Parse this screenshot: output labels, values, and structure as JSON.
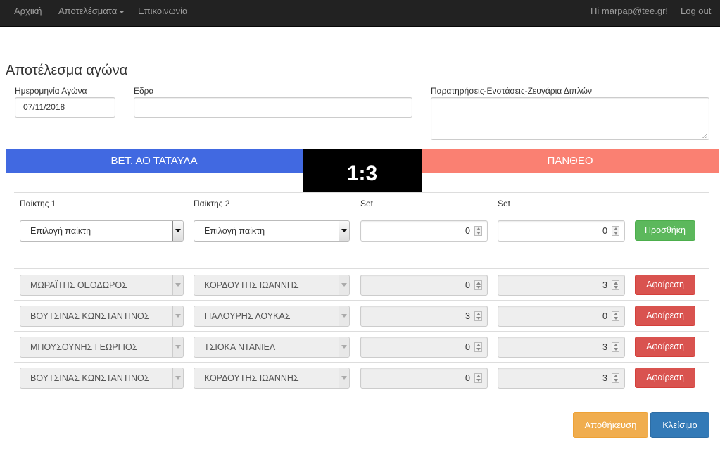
{
  "navbar": {
    "home": "Αρχική",
    "results": "Αποτελέσματα",
    "contact": "Επικοινωνία",
    "greeting": "Hi marpap@tee.gr!",
    "logout": "Log out"
  },
  "form": {
    "title": "Αποτέλεσμα αγώνα",
    "date_label": "Ημερομηνία Αγώνα",
    "date_value": "07/11/2018",
    "venue_label": "Εδρα",
    "venue_value": "",
    "notes_label": "Παρατηρήσεις-Ενστάσεις-Ζευγάρια Διπλών",
    "notes_value": ""
  },
  "match": {
    "home_team": "ΒΕΤ. ΑΟ ΤΑΤΑΥΛΑ",
    "away_team": "ΠΑΝΘΕΟ",
    "score": "1:3",
    "home_color": "#4169e1",
    "away_color": "#fa8072",
    "score_bg": "#000000"
  },
  "table": {
    "headers": [
      "Παίκτης 1",
      "Παίκτης 2",
      "Set",
      "Set"
    ],
    "new_row": {
      "player1": "Επιλογή παίκτη",
      "player2": "Επιλογή παίκτη",
      "set1": "0",
      "set2": "0",
      "button": "Προσθήκη"
    },
    "rows": [
      {
        "player1": "ΜΩΡΑΪΤΗΣ ΘΕΟΔΩΡΟΣ",
        "player2": "ΚΟΡΔΟΥΤΗΣ ΙΩΑΝΝΗΣ",
        "set1": "0",
        "set2": "3",
        "button": "Αφαίρεση"
      },
      {
        "player1": "ΒΟΥΤΣΙΝΑΣ ΚΩΝΣΤΑΝΤΙΝΟΣ",
        "player2": "ΓΙΑΛΟΥΡΗΣ ΛΟΥΚΑΣ",
        "set1": "3",
        "set2": "0",
        "button": "Αφαίρεση"
      },
      {
        "player1": "ΜΠΟΥΣΟΥΝΗΣ ΓΕΩΡΓΙΟΣ",
        "player2": "ΤΣΙΟΚΑ ΝΤΑΝΙΕΛ",
        "set1": "0",
        "set2": "3",
        "button": "Αφαίρεση"
      },
      {
        "player1": "ΒΟΥΤΣΙΝΑΣ ΚΩΝΣΤΑΝΤΙΝΟΣ",
        "player2": "ΚΟΡΔΟΥΤΗΣ ΙΩΑΝΝΗΣ",
        "set1": "0",
        "set2": "3",
        "button": "Αφαίρεση"
      }
    ]
  },
  "footer": {
    "save": "Αποθήκευση",
    "close": "Κλείσιμο"
  }
}
